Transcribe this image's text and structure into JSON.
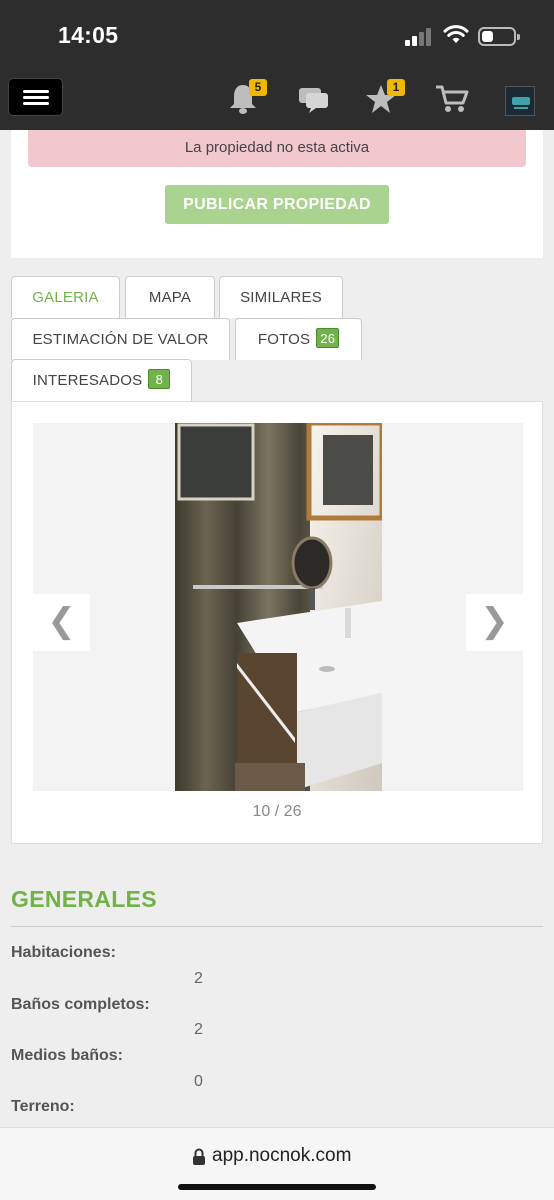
{
  "status_bar": {
    "time": "14:05",
    "battery_level": 0.35
  },
  "navbar": {
    "notifications_badge": "5",
    "favorites_badge": "1",
    "icons": [
      "menu-icon",
      "bell-icon",
      "chat-icon",
      "star-icon",
      "cart-icon",
      "avatar"
    ]
  },
  "property": {
    "status_message": "La propiedad no esta activa",
    "publish_label": "PUBLICAR PROPIEDAD"
  },
  "tabs": [
    {
      "label": "GALERIA",
      "active": true
    },
    {
      "label": "MAPA"
    },
    {
      "label": "SIMILARES"
    },
    {
      "label": "ESTIMACIÓN DE VALOR"
    },
    {
      "label": "FOTOS",
      "badge": "26"
    },
    {
      "label": "INTERESADOS",
      "badge": "8"
    }
  ],
  "gallery": {
    "prev_label": "❮",
    "next_label": "❯",
    "counter": "10 / 26"
  },
  "generales": {
    "title": "GENERALES",
    "fields": [
      {
        "label": "Habitaciones:",
        "value": "2"
      },
      {
        "label": "Baños completos:",
        "value": "2"
      },
      {
        "label": "Medios baños:",
        "value": "0"
      },
      {
        "label": "Terreno:",
        "value": ""
      }
    ]
  },
  "browser": {
    "url": "app.nocnok.com"
  },
  "colors": {
    "accent_green": "#72b24b",
    "badge_yellow": "#f2b705",
    "alert_pink": "#f2c8cf",
    "publish_green": "#a9d38e",
    "nav_dark": "#2d2d2d"
  }
}
